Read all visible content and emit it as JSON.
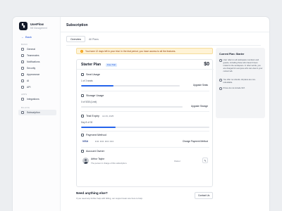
{
  "brand": {
    "name": "UserFlow",
    "subtitle": "Bill Management",
    "logo_icon": "logo-mark"
  },
  "sidebar": {
    "back_label": "Back",
    "sections": [
      {
        "heading": "BASIC",
        "items": [
          {
            "label": "General",
            "icon": "home-icon"
          },
          {
            "label": "Teammates",
            "icon": "users-icon"
          },
          {
            "label": "Notifications",
            "icon": "bell-icon"
          },
          {
            "label": "Security",
            "icon": "shield-icon"
          },
          {
            "label": "Appearance",
            "icon": "palette-icon"
          },
          {
            "label": "AI",
            "icon": "sparkle-icon"
          },
          {
            "label": "API",
            "icon": "code-icon"
          }
        ]
      },
      {
        "heading": "APPS",
        "items": [
          {
            "label": "Integrations",
            "icon": "puzzle-icon"
          }
        ]
      },
      {
        "heading": "BILLING",
        "items": [
          {
            "label": "Subscription",
            "icon": "card-icon",
            "active": true
          }
        ]
      }
    ]
  },
  "page": {
    "title": "Subscription"
  },
  "tabs": [
    {
      "label": "Overview",
      "active": true
    },
    {
      "label": "All Plans",
      "active": false
    }
  ],
  "trial_banner": {
    "text": "You have 12 days left in your trial. In the trial period, you have access to all the features.",
    "color": "#fff3d6"
  },
  "plan": {
    "name": "Starter Plan",
    "badge": "Free Trial",
    "price": "$0",
    "seat_usage": {
      "title": "Seat Usage",
      "value": "1 of 3 seats",
      "progress": 0.33,
      "action": "Upgrade Seats"
    },
    "storage_usage": {
      "title": "Storage Usage",
      "value": "0 of 5GB (Limit)",
      "progress": 0.0,
      "action": "Upgrade Storage"
    },
    "trial_expiry": {
      "title": "Trial Expiry",
      "date": "Jul 29, 2025",
      "value": "Day 8 of 30",
      "progress": 0.27
    },
    "payment_method": {
      "title": "Payment Method",
      "brand": "VISA",
      "masked": "•••• •••• •••• ••••",
      "action": "Change Payment Method"
    },
    "account_owner": {
      "title": "Account Owner",
      "name": "Arthur Taylor",
      "description": "The person in charge of this subscription.",
      "role": "Owner"
    }
  },
  "help": {
    "title": "Need anything else?",
    "text": "If you need any further help with billing, our support team are here to help.",
    "button": "Contact Us"
  },
  "info_panel": {
    "title": "Current Plan: Starter",
    "items": [
      "User refers to all workspace members and guests, including those who haven't been invited to the workspace. In other words, you are charged for everyone who can view in your current tab.",
      "You offer no refunds. All plans are non-refundable.",
      "Prices do not include VAT."
    ]
  },
  "colors": {
    "accent": "#2563eb",
    "warning": "#f59e0b"
  }
}
